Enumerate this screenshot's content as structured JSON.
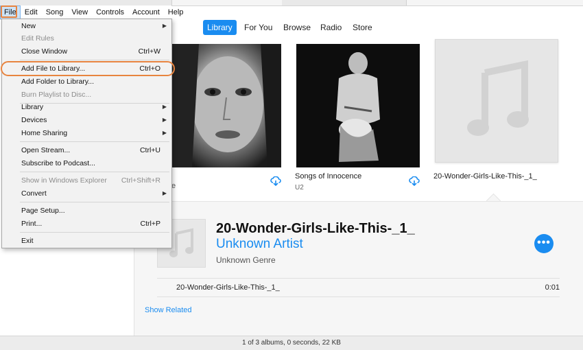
{
  "menubar": [
    "File",
    "Edit",
    "Song",
    "View",
    "Controls",
    "Account",
    "Help"
  ],
  "tabs": [
    "Library",
    "For You",
    "Browse",
    "Radio",
    "Store"
  ],
  "file_menu": [
    {
      "label": "New",
      "shortcut": "",
      "submenu": true,
      "disabled": false
    },
    {
      "label": "Edit Rules",
      "shortcut": "",
      "submenu": false,
      "disabled": true
    },
    {
      "label": "Close Window",
      "shortcut": "Ctrl+W",
      "submenu": false,
      "disabled": false
    },
    {
      "label": "Add File to Library...",
      "shortcut": "Ctrl+O",
      "submenu": false,
      "disabled": false
    },
    {
      "label": "Add Folder to Library...",
      "shortcut": "",
      "submenu": false,
      "disabled": false
    },
    {
      "label": "Burn Playlist to Disc...",
      "shortcut": "",
      "submenu": false,
      "disabled": true
    },
    {
      "label": "Library",
      "shortcut": "",
      "submenu": true,
      "disabled": false
    },
    {
      "label": "Devices",
      "shortcut": "",
      "submenu": true,
      "disabled": false
    },
    {
      "label": "Home Sharing",
      "shortcut": "",
      "submenu": true,
      "disabled": false
    },
    {
      "label": "Open Stream...",
      "shortcut": "Ctrl+U",
      "submenu": false,
      "disabled": false
    },
    {
      "label": "Subscribe to Podcast...",
      "shortcut": "",
      "submenu": false,
      "disabled": false
    },
    {
      "label": "Show in Windows Explorer",
      "shortcut": "Ctrl+Shift+R",
      "submenu": false,
      "disabled": true
    },
    {
      "label": "Convert",
      "shortcut": "",
      "submenu": true,
      "disabled": false
    },
    {
      "label": "Page Setup...",
      "shortcut": "",
      "submenu": false,
      "disabled": false
    },
    {
      "label": "Print...",
      "shortcut": "Ctrl+P",
      "submenu": false,
      "disabled": false
    },
    {
      "label": "Exit",
      "shortcut": "",
      "submenu": false,
      "disabled": false
    }
  ],
  "albums": [
    {
      "title": "",
      "subtitle": "e"
    },
    {
      "title": "Songs of Innocence",
      "subtitle": "U2"
    },
    {
      "title": "20-Wonder-Girls-Like-This-_1_",
      "subtitle": ""
    }
  ],
  "detail": {
    "title": "20-Wonder-Girls-Like-This-_1_",
    "artist": "Unknown Artist",
    "genre": "Unknown Genre",
    "more_button": "•••",
    "track": {
      "name": "20-Wonder-Girls-Like-This-_1_",
      "duration": "0:01"
    },
    "show_related": "Show Related"
  },
  "status_text": "1 of 3 albums, 0 seconds, 22 KB",
  "colors": {
    "accent": "#1a8cf0",
    "highlight_ring": "#e8843f"
  },
  "icons": {
    "cloud_download": "cloud-download-icon",
    "music_note": "music-note-icon",
    "submenu_arrow": "chevron-right-icon"
  }
}
